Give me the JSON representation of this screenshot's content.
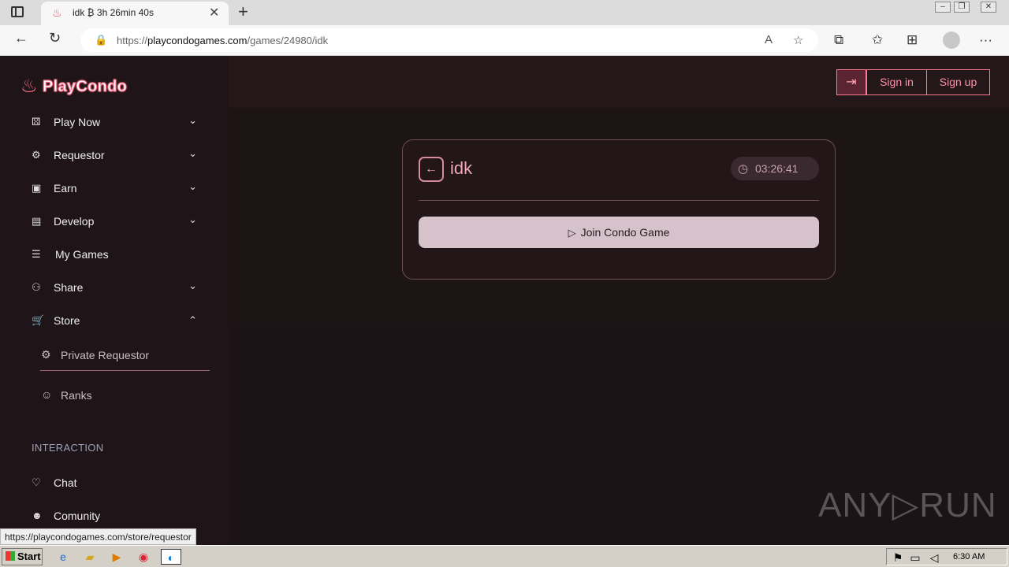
{
  "browser": {
    "tab_title": "idk ₿ 3h 26min 40s",
    "url_prefix": "https://",
    "url_domain": "playcondogames.com",
    "url_path": "/games/24980/idk"
  },
  "sidebar": {
    "logo_text": "PlayCondo",
    "items": [
      {
        "label": "Play Now",
        "icon": "dice-icon"
      },
      {
        "label": "Requestor",
        "icon": "robot-icon"
      },
      {
        "label": "Earn",
        "icon": "cash-icon"
      },
      {
        "label": "Develop",
        "icon": "code-file-icon"
      },
      {
        "label": "My Games",
        "icon": "list-heart-icon"
      },
      {
        "label": "Share",
        "icon": "share-icon"
      },
      {
        "label": "Store",
        "icon": "cart-icon"
      }
    ],
    "sub_items": [
      {
        "label": "Private Requestor"
      },
      {
        "label": "Ranks"
      }
    ],
    "section_label": "INTERACTION",
    "interaction_items": [
      {
        "label": "Chat"
      },
      {
        "label": "Comunity"
      }
    ]
  },
  "topbar": {
    "signin_label": "Sign in",
    "signup_label": "Sign up"
  },
  "game_card": {
    "title": "idk",
    "timer": "03:26:41",
    "join_label": "Join Condo Game"
  },
  "status_url": "https://playcondogames.com/store/requestor",
  "watermark": "ANY▷RUN",
  "taskbar": {
    "start_label": "Start",
    "time": "6:30 AM"
  }
}
